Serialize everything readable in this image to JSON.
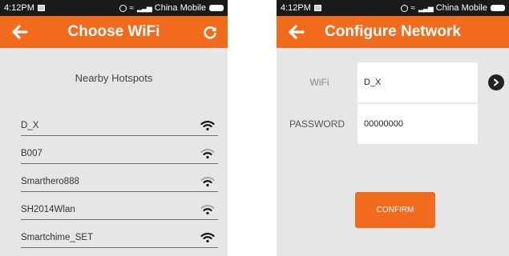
{
  "left_screen": {
    "status": {
      "time": "4:12PM",
      "carrier": "China Mobile"
    },
    "appbar": {
      "title": "Choose WiFi"
    },
    "subtitle": "Nearby Hotspots",
    "networks": [
      {
        "ssid": "D_X",
        "signal": "strong"
      },
      {
        "ssid": "B007",
        "signal": "medium"
      },
      {
        "ssid": "Smarthero888",
        "signal": "medium"
      },
      {
        "ssid": "SH2014Wlan",
        "signal": "medium"
      },
      {
        "ssid": "Smartchime_SET",
        "signal": "strong"
      }
    ]
  },
  "right_screen": {
    "status": {
      "time": "4:12PM",
      "carrier": "China Mobile"
    },
    "appbar": {
      "title": "Configure Network"
    },
    "form": {
      "wifi_label": "WiFi",
      "wifi_value": "D_X",
      "password_label": "PASSWORD",
      "password_value": "00000000"
    },
    "confirm_label": "CONFIRM"
  },
  "colors": {
    "accent": "#f26a1b",
    "background": "#e6e6e6",
    "statusbar": "#1a1a1a"
  }
}
